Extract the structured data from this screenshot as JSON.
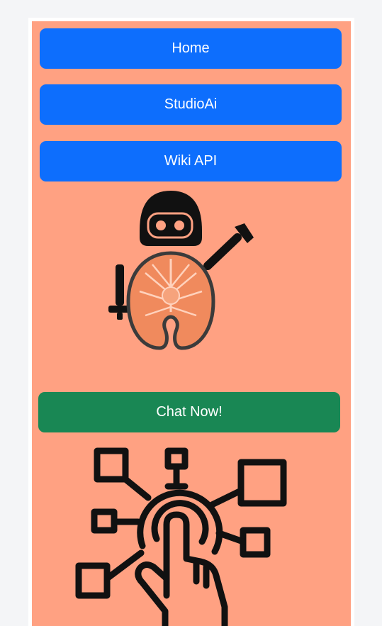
{
  "nav": {
    "items": [
      {
        "label": "Home"
      },
      {
        "label": "StudioAi"
      },
      {
        "label": "Wiki API"
      }
    ]
  },
  "chat": {
    "label": "Chat Now!"
  },
  "icons": {
    "mascot": "salmon-robot-icon",
    "network": "touch-network-icon"
  },
  "colors": {
    "panel_bg": "#ffa182",
    "nav_button": "#0d6efd",
    "chat_button": "#198754",
    "page_bg": "#f4f5f7"
  }
}
